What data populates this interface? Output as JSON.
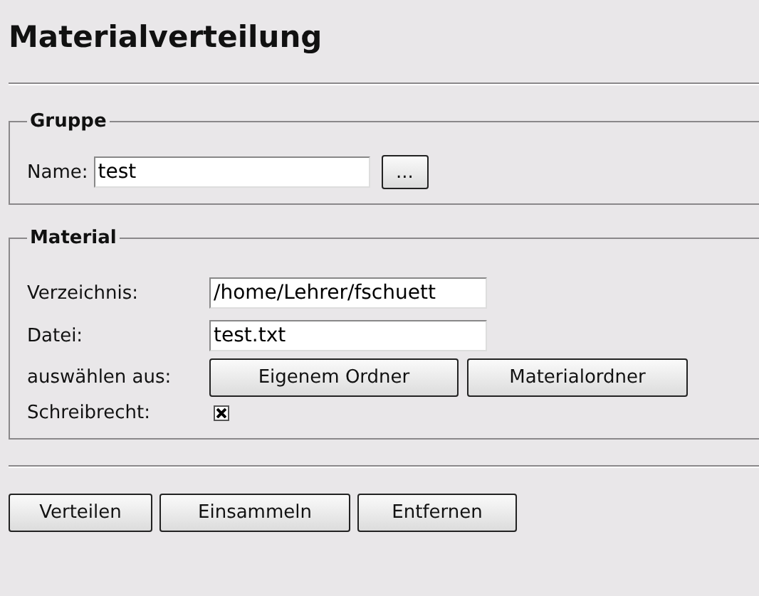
{
  "title": "Materialverteilung",
  "gruppe": {
    "legend": "Gruppe",
    "name_label": "Name:",
    "name_value": "test",
    "browse_button": "..."
  },
  "material": {
    "legend": "Material",
    "fields": [
      {
        "label": "Verzeichnis:",
        "value": "/home/Lehrer/fschuett"
      },
      {
        "label": "Datei:",
        "value": "test.txt"
      }
    ],
    "select_label": "auswählen aus:",
    "select_buttons": [
      "Eigenem Ordner",
      "Materialordner"
    ],
    "write_label": "Schreibrecht:",
    "write_checked": true
  },
  "buttons": [
    "Verteilen",
    "Einsammeln",
    "Entfernen"
  ]
}
